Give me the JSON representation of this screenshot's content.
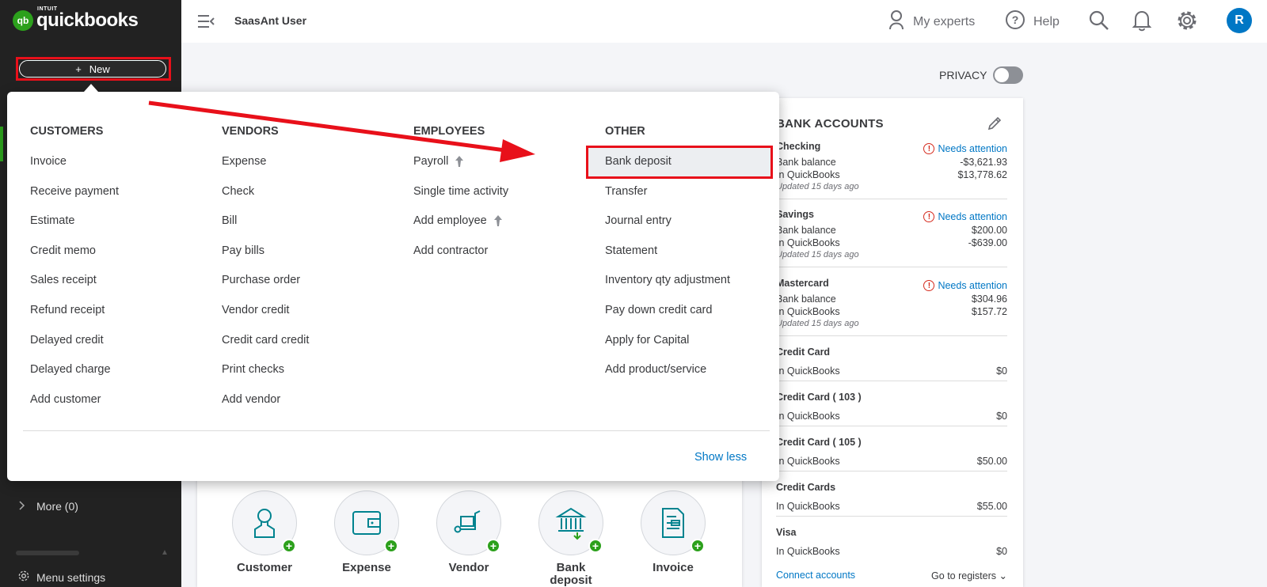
{
  "app": {
    "logo_mark": "qb",
    "logo_top": "INTUIT",
    "logo_word": "quickbooks",
    "new_button": "New",
    "new_plus": "+",
    "company": "SaasAnt User"
  },
  "topbar": {
    "my_experts": "My experts",
    "help": "Help",
    "avatar": "R"
  },
  "privacy": {
    "label": "PRIVACY",
    "on": false
  },
  "sidebar": {
    "more": "More (0)",
    "menu_settings": "Menu settings"
  },
  "menu": {
    "columns": [
      {
        "title": "CUSTOMERS",
        "items": [
          "Invoice",
          "Receive payment",
          "Estimate",
          "Credit memo",
          "Sales receipt",
          "Refund receipt",
          "Delayed credit",
          "Delayed charge",
          "Add customer"
        ]
      },
      {
        "title": "VENDORS",
        "items": [
          "Expense",
          "Check",
          "Bill",
          "Pay bills",
          "Purchase order",
          "Vendor credit",
          "Credit card credit",
          "Print checks",
          "Add vendor"
        ]
      },
      {
        "title": "EMPLOYEES",
        "items": [
          "Payroll",
          "Single time activity",
          "Add employee",
          "Add contractor"
        ]
      },
      {
        "title": "OTHER",
        "items": [
          "Bank deposit",
          "Transfer",
          "Journal entry",
          "Statement",
          "Inventory qty adjustment",
          "Pay down credit card",
          "Apply for Capital",
          "Add product/service"
        ]
      }
    ],
    "show_less": "Show less"
  },
  "bank_accounts": {
    "title": "BANK ACCOUNTS",
    "needs_attention": "Needs attention",
    "accounts": [
      {
        "name": "Checking",
        "attention": true,
        "bank_label": "Bank balance",
        "bank": "-$3,621.93",
        "qb_label": "In QuickBooks",
        "qb": "$13,778.62",
        "updated": "Updated 15 days ago"
      },
      {
        "name": "Savings",
        "attention": true,
        "bank_label": "Bank balance",
        "bank": "$200.00",
        "qb_label": "In QuickBooks",
        "qb": "-$639.00",
        "updated": "Updated 15 days ago"
      },
      {
        "name": "Mastercard",
        "attention": true,
        "bank_label": "Bank balance",
        "bank": "$304.96",
        "qb_label": "In QuickBooks",
        "qb": "$157.72",
        "updated": "Updated 15 days ago"
      },
      {
        "name": "Credit Card",
        "qb_label": "In QuickBooks",
        "qb": "$0"
      },
      {
        "name": "Credit Card ( 103 )",
        "qb_label": "In QuickBooks",
        "qb": "$0"
      },
      {
        "name": "Credit Card ( 105 )",
        "qb_label": "In QuickBooks",
        "qb": "$50.00"
      },
      {
        "name": "Credit Cards",
        "qb_label": "In QuickBooks",
        "qb": "$55.00"
      },
      {
        "name": "Visa",
        "qb_label": "In QuickBooks",
        "qb": "$0"
      }
    ],
    "connect": "Connect accounts",
    "go_to_registers": "Go to registers"
  },
  "shortcuts": [
    "Customer",
    "Expense",
    "Vendor",
    "Bank deposit",
    "Invoice"
  ],
  "colors": {
    "brand_green": "#2ca01c",
    "link_blue": "#0077c5",
    "annotation_red": "#e8101a",
    "sidebar": "#222222"
  }
}
